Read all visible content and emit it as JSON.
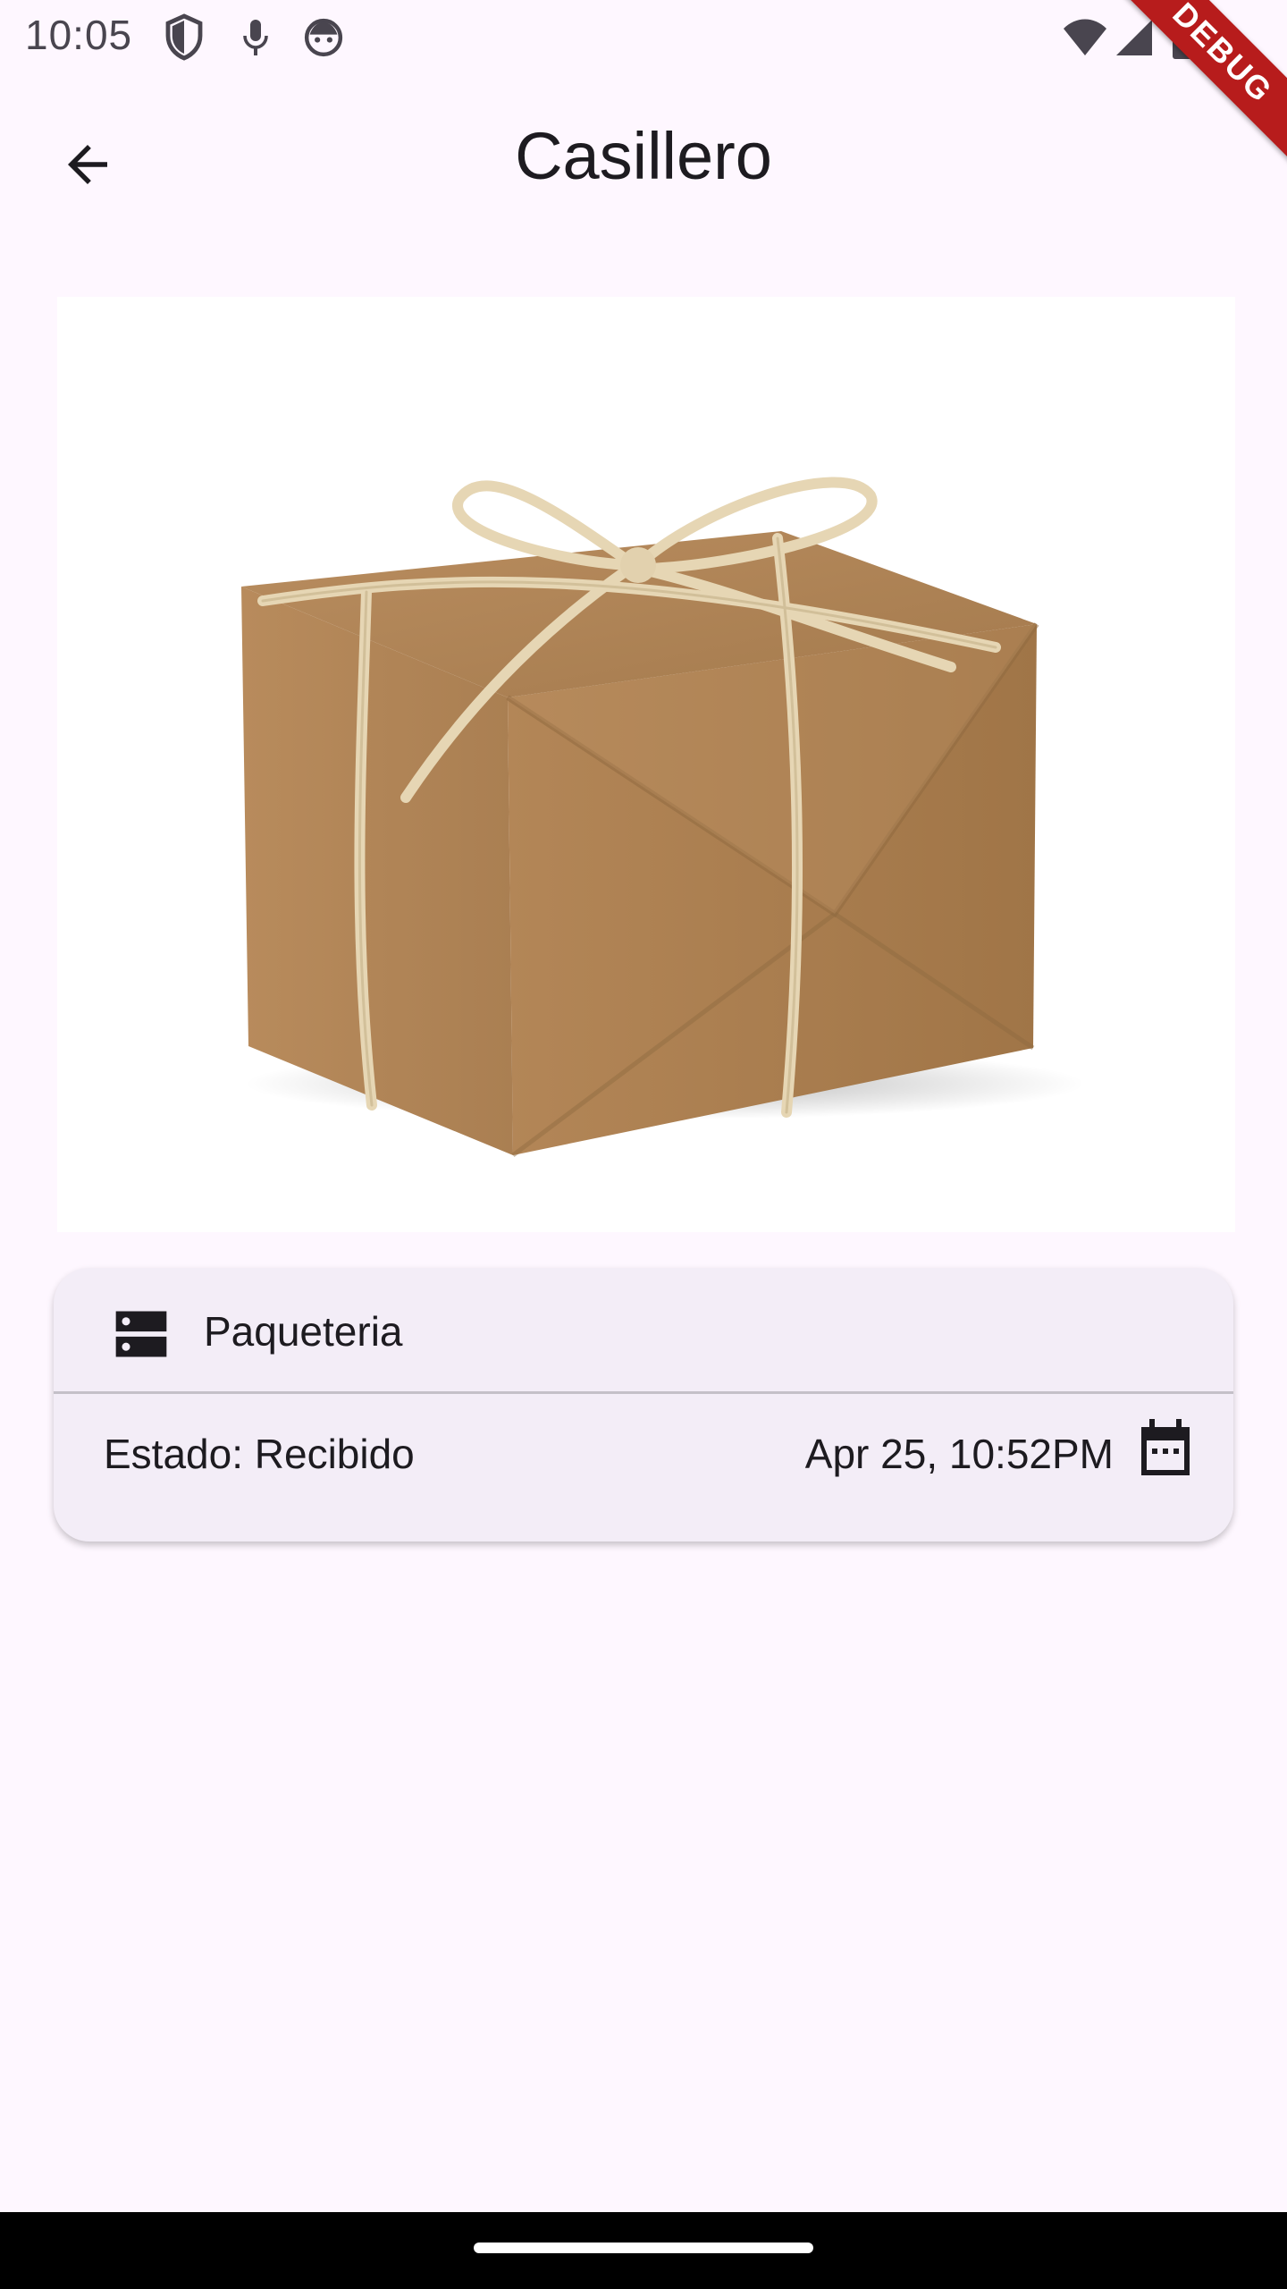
{
  "status_bar": {
    "time": "10:05",
    "icons": [
      "shield-icon",
      "mic-icon",
      "assistant-face-icon",
      "wifi-icon",
      "cellular-icon",
      "battery-icon"
    ]
  },
  "debug_banner": {
    "label": "DEBUG",
    "color": "#b71c1c"
  },
  "app_bar": {
    "title": "Casillero",
    "back_icon": "arrow-back-icon"
  },
  "package_image": {
    "description_icon": "package-icon"
  },
  "info_card": {
    "category_icon": "storage-icon",
    "category": "Paqueteria",
    "status": "Estado: Recibido",
    "date": "Apr 25, 10:52PM",
    "date_icon": "calendar-icon"
  },
  "colors": {
    "background": "#fef7ff",
    "card_background": "#f3edf7",
    "text": "#1d1b20",
    "status_text": "#49454f"
  }
}
